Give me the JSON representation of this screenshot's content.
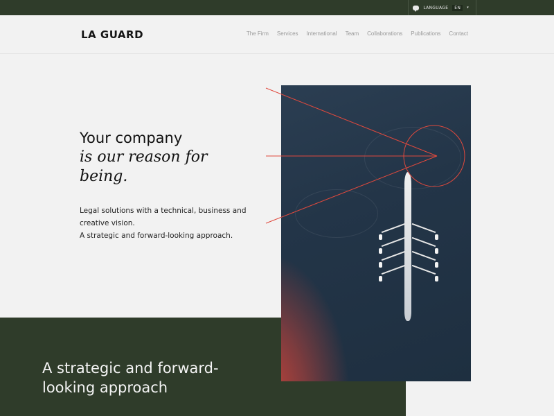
{
  "topbar": {
    "language_label": "LANGUAGE",
    "language_code": "EN",
    "language_caret": "▾",
    "chat_icon": "chat-bubble-icon"
  },
  "header": {
    "logo": "LA GUARD",
    "nav": [
      {
        "label": "The Firm"
      },
      {
        "label": "Services"
      },
      {
        "label": "International"
      },
      {
        "label": "Team"
      },
      {
        "label": "Collaborations"
      },
      {
        "label": "Publications"
      },
      {
        "label": "Contact"
      }
    ]
  },
  "hero": {
    "title": "Your company",
    "italic": "is our reason for being.",
    "desc_line1": "Legal solutions with a technical, business and creative vision.",
    "desc_line2": "A strategic and forward-looking approach."
  },
  "section": {
    "title": "A strategic and forward-looking approach"
  },
  "colors": {
    "dark_green": "#2f3c2a",
    "accent_red": "#e0493d",
    "background": "#f2f2f2"
  }
}
